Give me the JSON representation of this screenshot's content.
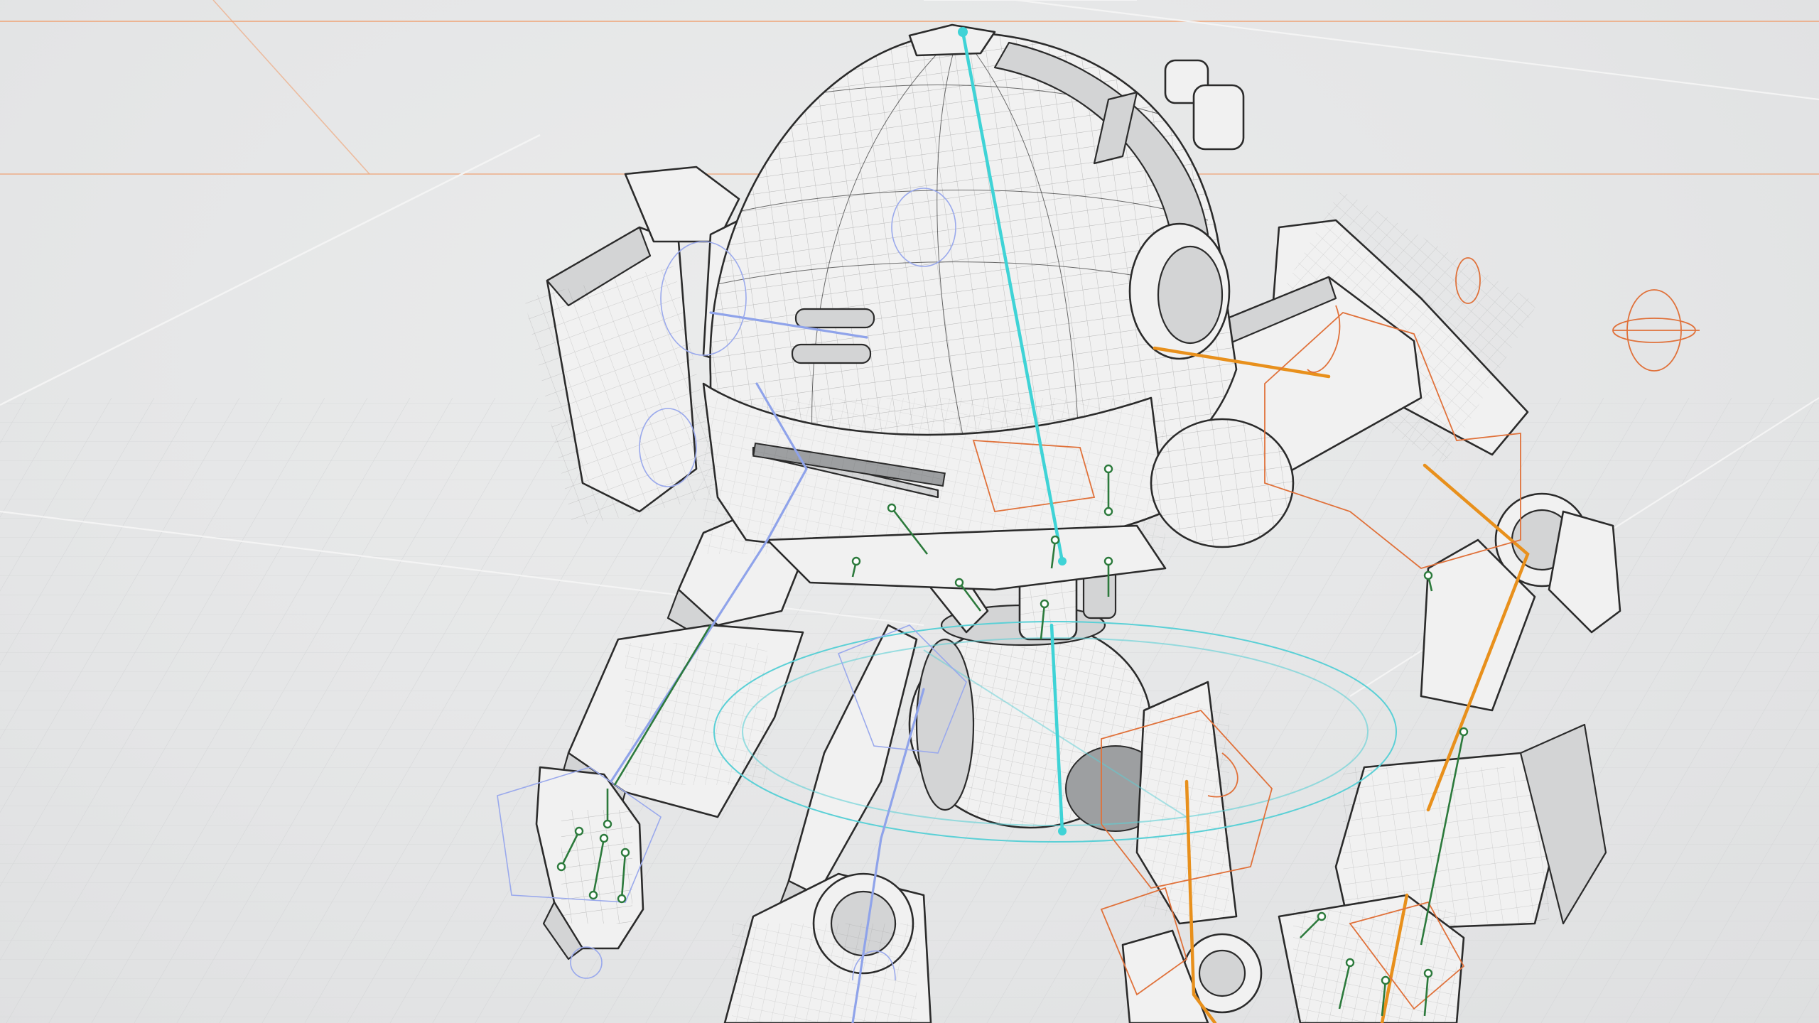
{
  "viewport": {
    "background_color": "#e6e7e8",
    "mesh_color": "#f1f1f1",
    "wire_color": "#2b2b2b",
    "colors": {
      "spine_bone": "#3fd3d6",
      "right_side_bone": "#e8901c",
      "left_side_bone": "#8fa3ea",
      "helper_bone": "#2c7a3c",
      "right_controller": "#e0713a",
      "left_controller": "#9aa9ec",
      "root_controller": "#5bd0d6",
      "grid_accent": "#f0a070"
    },
    "icons": [
      "mech-model",
      "armature-skeleton",
      "ground-grid",
      "rig-controller"
    ]
  }
}
